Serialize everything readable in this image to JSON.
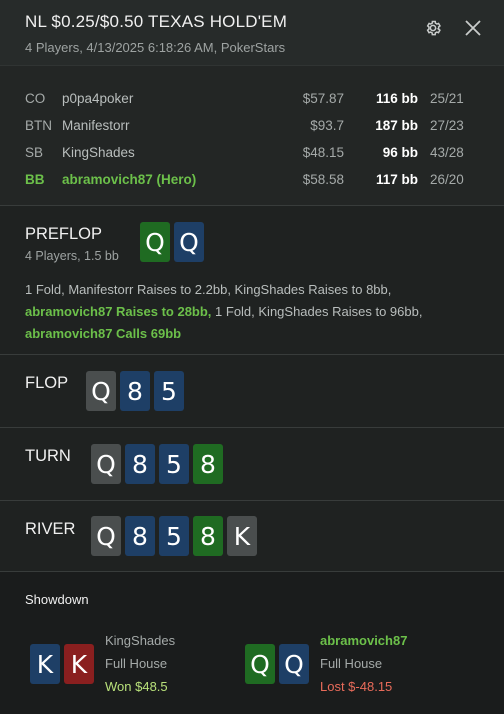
{
  "header": {
    "title": "NL $0.25/$0.50 TEXAS HOLD'EM",
    "subtitle": "4 Players, 4/13/2025 6:18:26 AM, PokerStars"
  },
  "players": [
    {
      "pos": "CO",
      "name": "p0pa4poker",
      "stack": "$57.87",
      "bb": "116 bb",
      "stat": "25/21",
      "hero": false
    },
    {
      "pos": "BTN",
      "name": "Manifestorr",
      "stack": "$93.7",
      "bb": "187 bb",
      "stat": "27/23",
      "hero": false
    },
    {
      "pos": "SB",
      "name": "KingShades",
      "stack": "$48.15",
      "bb": "96 bb",
      "stat": "43/28",
      "hero": false
    },
    {
      "pos": "BB",
      "name": "abramovich87 (Hero)",
      "stack": "$58.58",
      "bb": "117 bb",
      "stat": "26/20",
      "hero": true
    }
  ],
  "preflop": {
    "label": "PREFLOP",
    "sub": "4 Players, 1.5 bb",
    "hero_cards": [
      {
        "rank": "Q",
        "suit": "c"
      },
      {
        "rank": "Q",
        "suit": "d"
      }
    ],
    "action_1": "1 Fold, Manifestorr Raises to 2.2bb, KingShades Raises to 8bb,",
    "action_2_hero": "abramovich87 Raises to 28bb,",
    "action_2_rest": " 1 Fold, KingShades Raises to 96bb,",
    "action_3_hero": "abramovich87 Calls 69bb"
  },
  "flop": {
    "label": "FLOP",
    "cards": [
      {
        "rank": "Q",
        "suit": "s"
      },
      {
        "rank": "8",
        "suit": "d"
      },
      {
        "rank": "5",
        "suit": "d"
      }
    ]
  },
  "turn": {
    "label": "TURN",
    "cards": [
      {
        "rank": "Q",
        "suit": "s"
      },
      {
        "rank": "8",
        "suit": "d"
      },
      {
        "rank": "5",
        "suit": "d"
      },
      {
        "rank": "8",
        "suit": "c"
      }
    ]
  },
  "river": {
    "label": "RIVER",
    "cards": [
      {
        "rank": "Q",
        "suit": "s"
      },
      {
        "rank": "8",
        "suit": "d"
      },
      {
        "rank": "5",
        "suit": "d"
      },
      {
        "rank": "8",
        "suit": "c"
      },
      {
        "rank": "K",
        "suit": "s"
      }
    ]
  },
  "showdown": {
    "title": "Showdown",
    "players": [
      {
        "name": "KingShades",
        "hand": "Full House",
        "result": "Won $48.5",
        "cards": [
          {
            "rank": "K",
            "suit": "d"
          },
          {
            "rank": "K",
            "suit": "h"
          }
        ],
        "won": true
      },
      {
        "name": "abramovich87",
        "hand": "Full House",
        "result": "Lost $-48.15",
        "cards": [
          {
            "rank": "Q",
            "suit": "c"
          },
          {
            "rank": "Q",
            "suit": "d"
          }
        ],
        "won": false
      }
    ]
  },
  "colors": {
    "hero_green": "#6cc04a",
    "win": "#b8e07a",
    "loss": "#e86b5a",
    "spade": "#4a4e4e",
    "diamond": "#1e3f66",
    "club": "#1f6b22",
    "heart": "#8a1f1f"
  },
  "icons": [
    "gear-icon",
    "close-icon"
  ]
}
